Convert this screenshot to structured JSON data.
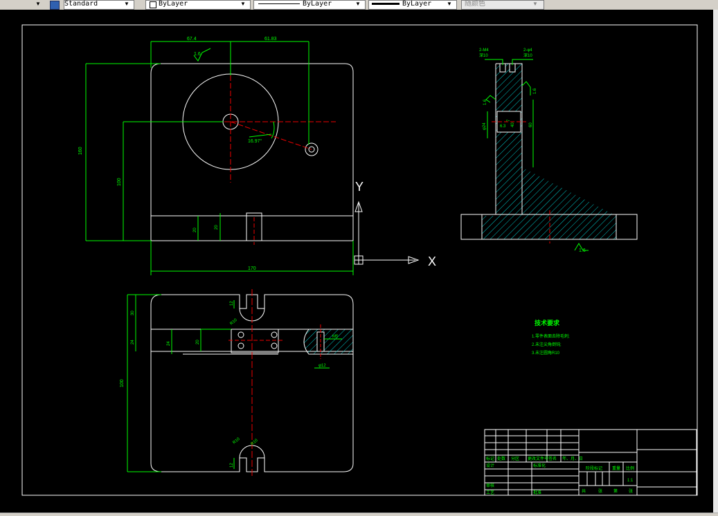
{
  "toolbar": {
    "text_style": "Standard",
    "layer_color": "ByLayer",
    "linetype": "ByLayer",
    "lineweight": "ByLayer",
    "plot_style": "随颜色"
  },
  "drawing": {
    "front_view": {
      "dim_top_left": "67.4",
      "dim_top_right": "61.83",
      "roughness_top": "1.6",
      "dim_height_total": "160",
      "dim_height_inner": "100",
      "dim_angle": "16.97°",
      "dim_slot_a": "20",
      "dim_slot_b": "20",
      "dim_bottom_width": "170"
    },
    "side_view": {
      "callout_left": "2-M4",
      "callout_left_sub": "深10",
      "callout_right": "2-φ4",
      "callout_right_sub": "深10",
      "roughness_right": "1.6",
      "roughness_left": "1.6",
      "dim_a": "φ24",
      "dim_b": "60",
      "dim_c": "7",
      "dim_d": "6.3",
      "dim_e": "40",
      "roughness_bottom": "1.6"
    },
    "top_view": {
      "dim_a": "12",
      "dim_b": "30",
      "dim_c": "24",
      "dim_d": "24",
      "dim_e": "20",
      "dim_f": "100",
      "dim_g": "R10",
      "dim_h": "R10",
      "dim_i": "R10",
      "dim_j": "12",
      "dim_k": "φ12",
      "dim_l": "M5"
    },
    "tech_req": {
      "title": "技术要求",
      "line1": "1.零件表面去除毛刺;",
      "line2": "2.未注尖角倒钝;",
      "line3": "3.未注圆角R10"
    },
    "title_block": {
      "h1": "标记",
      "h2": "处数",
      "h3": "分区",
      "h4": "更改文件号",
      "h5": "签名",
      "h6": "年、月、日",
      "design": "设计",
      "standard": "标准化",
      "stage": "阶段标记",
      "weight": "重量",
      "scale_label": "比例",
      "scale": "1:1",
      "review": "审核",
      "process": "工艺",
      "approve": "批准",
      "sheets": "共",
      "sheet_of": "张",
      "sheet_no": "第",
      "sheet_unit": "张"
    },
    "ucs": {
      "y": "Y",
      "x": "X"
    }
  }
}
